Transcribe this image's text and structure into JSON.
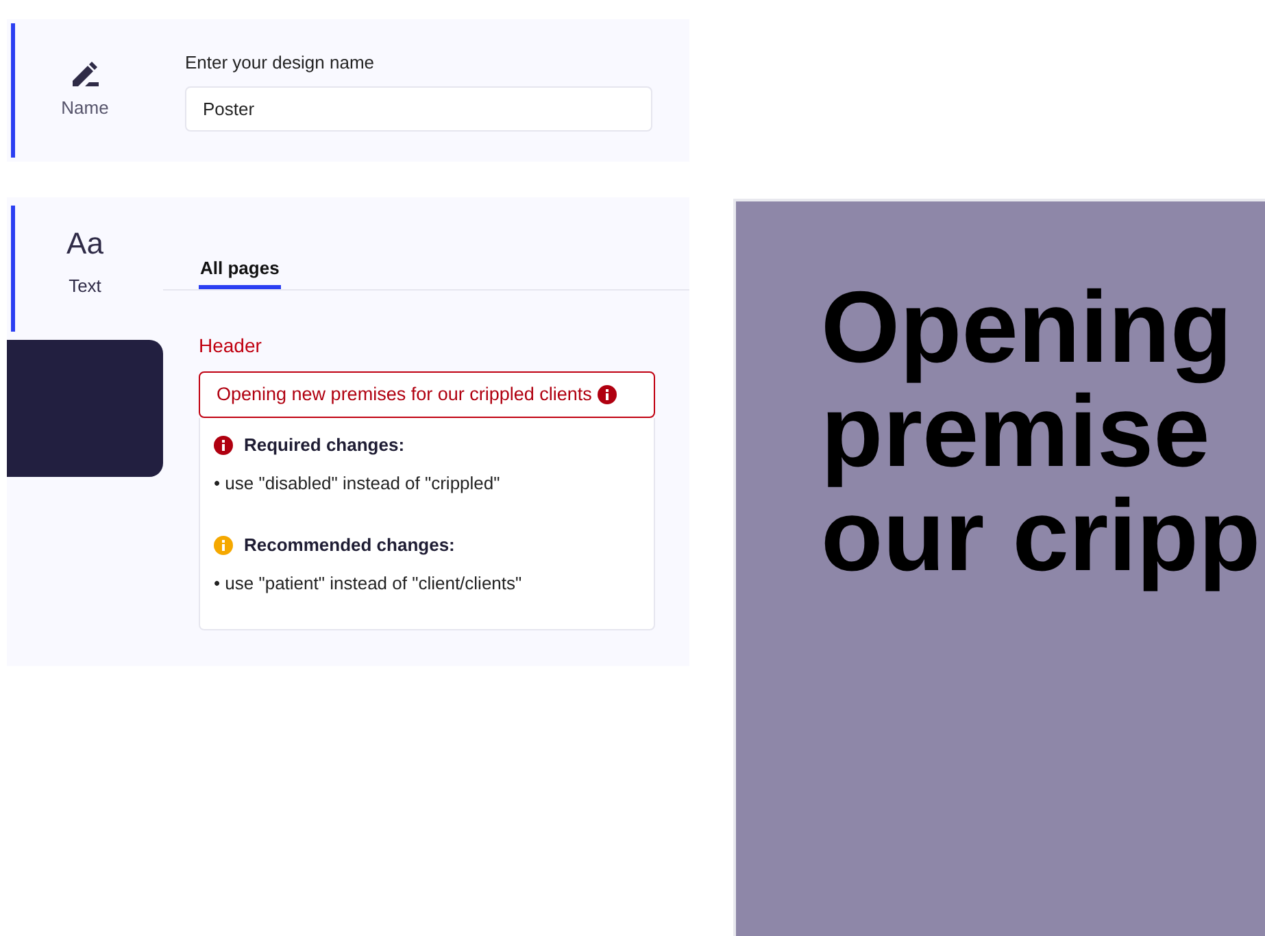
{
  "name_section": {
    "label": "Name",
    "selected": true,
    "field_label": "Enter your design name",
    "value": "Poster"
  },
  "text_section": {
    "glyph": "Aa",
    "label": "Text",
    "selected": true
  },
  "tabs": [
    {
      "label": "All pages",
      "selected": true
    }
  ],
  "header": {
    "label": "Header",
    "value": "Opening new premises for our crippled clients",
    "error": true
  },
  "issues": [
    {
      "kind": "required",
      "title": "Required changes:",
      "items": [
        "• use \"disabled\" instead of \"crippled\""
      ]
    },
    {
      "kind": "recommended",
      "title": "Recommended changes:",
      "items": [
        "• use \"patient\" instead of \"client/clients\""
      ]
    }
  ],
  "canvas": {
    "lines": [
      "Opening",
      "premise",
      "our cripp"
    ]
  }
}
